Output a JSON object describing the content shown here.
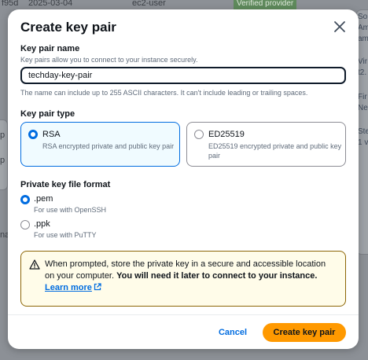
{
  "background": {
    "row_cells": [
      "f95d",
      "2025-03-04",
      "ec2-user"
    ],
    "badge": "Verified provider",
    "left_snippets": [
      "p",
      "p",
      "nav"
    ],
    "right_snippets": [
      "So",
      "Am",
      "am",
      "Vir",
      "t2.",
      "Fir",
      "Ne",
      "Ste",
      "1 v"
    ]
  },
  "modal": {
    "title": "Create key pair",
    "close_icon": "close-icon"
  },
  "key_name": {
    "label": "Key pair name",
    "description": "Key pairs allow you to connect to your instance securely.",
    "value": "techday-key-pair",
    "constraint": "The name can include up to 255 ASCII characters. It can't include leading or trailing spaces."
  },
  "key_type": {
    "label": "Key pair type",
    "options": [
      {
        "title": "RSA",
        "description": "RSA encrypted private and public key pair",
        "selected": true
      },
      {
        "title": "ED25519",
        "description": "ED25519 encrypted private and public key pair",
        "selected": false
      }
    ]
  },
  "file_format": {
    "label": "Private key file format",
    "options": [
      {
        "title": ".pem",
        "description": "For use with OpenSSH",
        "selected": true
      },
      {
        "title": ".ppk",
        "description": "For use with PuTTY",
        "selected": false
      }
    ]
  },
  "alert": {
    "icon": "warning-icon",
    "text_plain": "When prompted, store the private key in a secure and accessible location on your computer.",
    "text_bold": "You will need it later to connect to your instance.",
    "link_text": "Learn more",
    "link_icon": "external-link-icon"
  },
  "footer": {
    "cancel_label": "Cancel",
    "primary_label": "Create key pair"
  },
  "colors": {
    "accent": "#006ce0",
    "primary_button": "#ff9900",
    "warning_border": "#8d6605",
    "warning_bg": "#fffce9"
  }
}
